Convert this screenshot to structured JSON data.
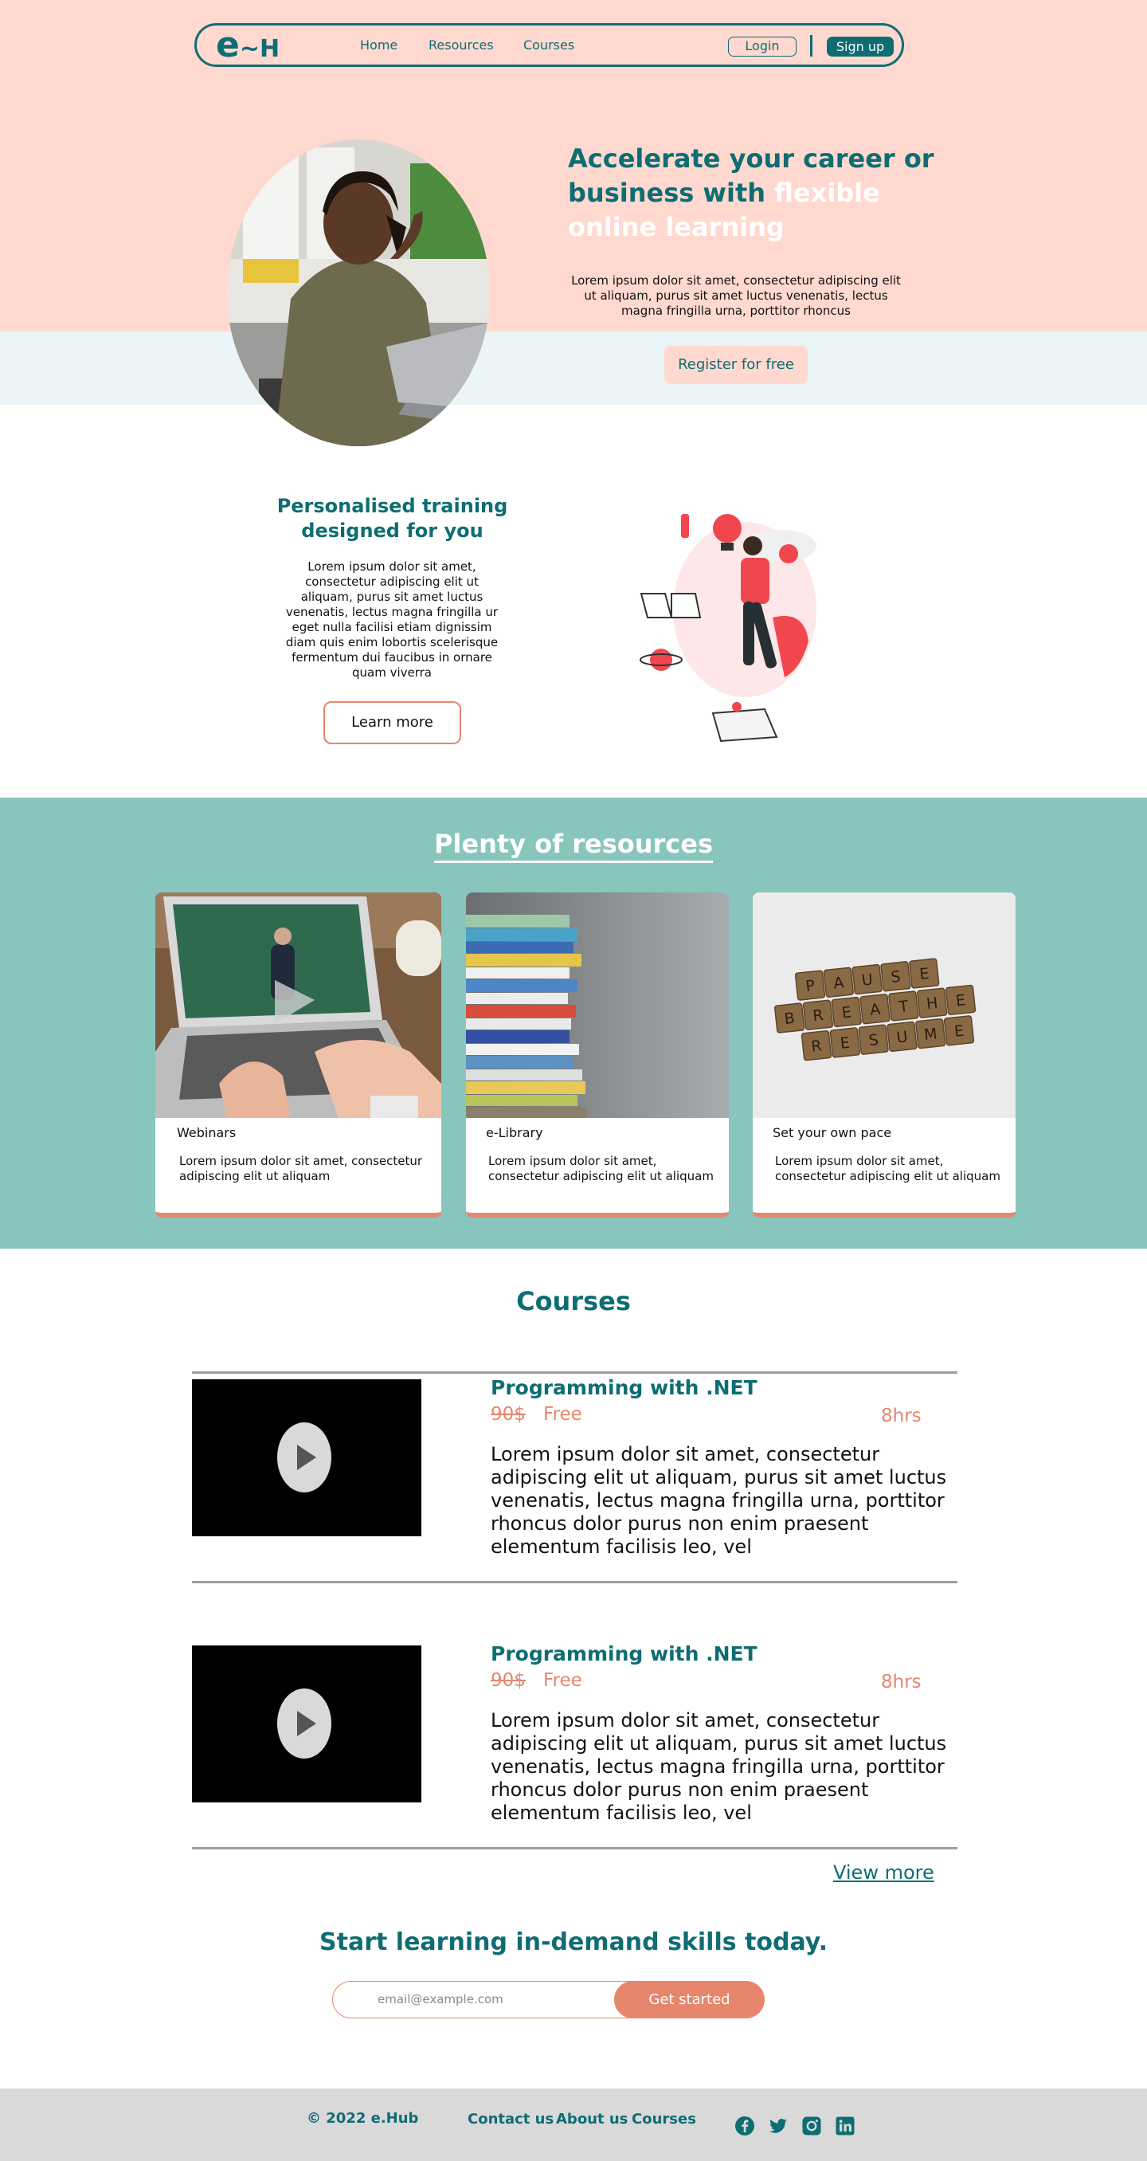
{
  "nav": {
    "logo_main": "e",
    "logo_tail": "~H",
    "links": [
      "Home",
      "Resources",
      "Courses"
    ],
    "login": "Login",
    "signup": "Sign up"
  },
  "hero": {
    "title_part1": "Accelerate your career or business with ",
    "title_highlight": "flexible online learning",
    "text": "Lorem ipsum dolor sit amet, consectetur adipiscing elit ut aliquam, purus sit amet luctus venenatis, lectus magna fringilla urna, porttitor rhoncus",
    "cta": "Register for free"
  },
  "personalised": {
    "title": "Personalised training designed for you",
    "text": "Lorem ipsum dolor sit amet, consectetur adipiscing elit ut aliquam, purus sit amet luctus venenatis, lectus magna fringilla ur eget nulla facilisi etiam dignissim diam quis enim lobortis scelerisque fermentum dui faucibus in ornare quam viverra",
    "cta": "Learn more"
  },
  "resources": {
    "title": "Plenty of resources",
    "cards": [
      {
        "label": "Webinars",
        "text": "Lorem ipsum dolor sit amet, consectetur adipiscing elit ut aliquam"
      },
      {
        "label": "e-Library",
        "text": "Lorem ipsum dolor sit amet, consectetur adipiscing elit ut aliquam"
      },
      {
        "label": "Set your own pace",
        "text": "Lorem ipsum dolor sit amet, consectetur adipiscing elit ut aliquam"
      }
    ],
    "tiles": [
      [
        "P",
        "A",
        "U",
        "S",
        "E"
      ],
      [
        "B",
        "R",
        "E",
        "A",
        "T",
        "H",
        "E"
      ],
      [
        "R",
        "E",
        "S",
        "U",
        "M",
        "E"
      ]
    ]
  },
  "courses": {
    "title": "Courses",
    "items": [
      {
        "title": "Programming with .NET",
        "old_price": "90$",
        "price": "Free",
        "duration": "8hrs",
        "description": "Lorem ipsum dolor sit amet, consectetur adipiscing elit ut aliquam, purus sit amet luctus venenatis, lectus magna fringilla urna, porttitor rhoncus dolor purus non enim praesent elementum facilisis leo, vel"
      },
      {
        "title": "Programming with .NET",
        "old_price": "90$",
        "price": "Free",
        "duration": "8hrs",
        "description": "Lorem ipsum dolor sit amet, consectetur adipiscing elit ut aliquam, purus sit amet luctus venenatis, lectus magna fringilla urna, porttitor rhoncus dolor purus non enim praesent elementum facilisis leo, vel"
      }
    ],
    "view_more": "View more"
  },
  "cta": {
    "title": "Start learning in-demand skills today.",
    "placeholder": "email@example.com",
    "button": "Get started"
  },
  "footer": {
    "copyright": "© 2022 e.Hub",
    "links": [
      "Contact us",
      "About us",
      "Courses"
    ],
    "social": [
      "facebook-icon",
      "twitter-icon",
      "instagram-icon",
      "linkedin-icon"
    ]
  },
  "colors": {
    "brand": "#0e6d72",
    "accent": "#e8866d",
    "hero_bg": "#ffd9cf",
    "resources_bg": "#87c5bd"
  }
}
